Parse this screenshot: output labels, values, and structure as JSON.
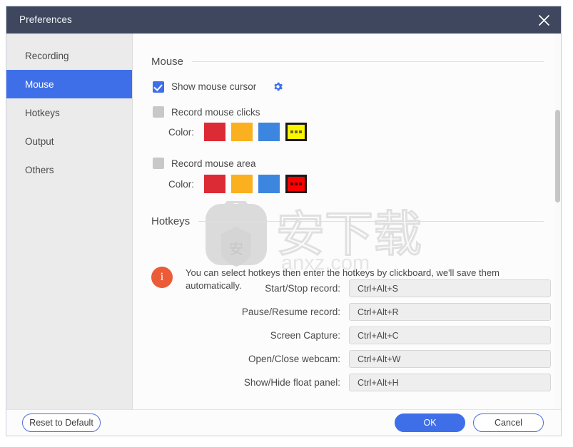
{
  "window": {
    "title": "Preferences",
    "close_icon": "close-icon"
  },
  "sidebar": {
    "items": [
      {
        "label": "Recording",
        "active": false
      },
      {
        "label": "Mouse",
        "active": true
      },
      {
        "label": "Hotkeys",
        "active": false
      },
      {
        "label": "Output",
        "active": false
      },
      {
        "label": "Others",
        "active": false
      }
    ]
  },
  "mouse_section": {
    "heading": "Mouse",
    "show_cursor": {
      "label": "Show mouse cursor",
      "checked": true,
      "settings_icon": "gear-icon"
    },
    "record_clicks": {
      "label": "Record mouse clicks",
      "checked": false,
      "color_label": "Color:",
      "swatches": [
        "#dc2b35",
        "#fbb01f",
        "#3c86e0",
        "#faf700"
      ],
      "selected_index": 3
    },
    "record_area": {
      "label": "Record mouse area",
      "checked": false,
      "color_label": "Color:",
      "swatches": [
        "#dc2b35",
        "#fbb01f",
        "#3c86e0",
        "#fc0000"
      ],
      "selected_index": 3
    }
  },
  "hotkeys_section": {
    "heading": "Hotkeys",
    "info_icon": "info-icon",
    "info_glyph": "i",
    "info_text": "You can select hotkeys then enter the hotkeys by clickboard, we'll save them automatically.",
    "rows": [
      {
        "label": "Start/Stop record:",
        "value": "Ctrl+Alt+S"
      },
      {
        "label": "Pause/Resume record:",
        "value": "Ctrl+Alt+R"
      },
      {
        "label": "Screen Capture:",
        "value": "Ctrl+Alt+C"
      },
      {
        "label": "Open/Close webcam:",
        "value": "Ctrl+Alt+W"
      },
      {
        "label": "Show/Hide float panel:",
        "value": "Ctrl+Alt+H"
      }
    ]
  },
  "footer": {
    "reset_label": "Reset to Default",
    "ok_label": "OK",
    "cancel_label": "Cancel"
  },
  "watermark": {
    "text_cn": "安下载",
    "text_domain": "anxz.com"
  },
  "colors": {
    "titlebar": "#3e475e",
    "accent": "#3f6fe8",
    "sidebar": "#ebebeb",
    "info": "#ec5b38"
  }
}
